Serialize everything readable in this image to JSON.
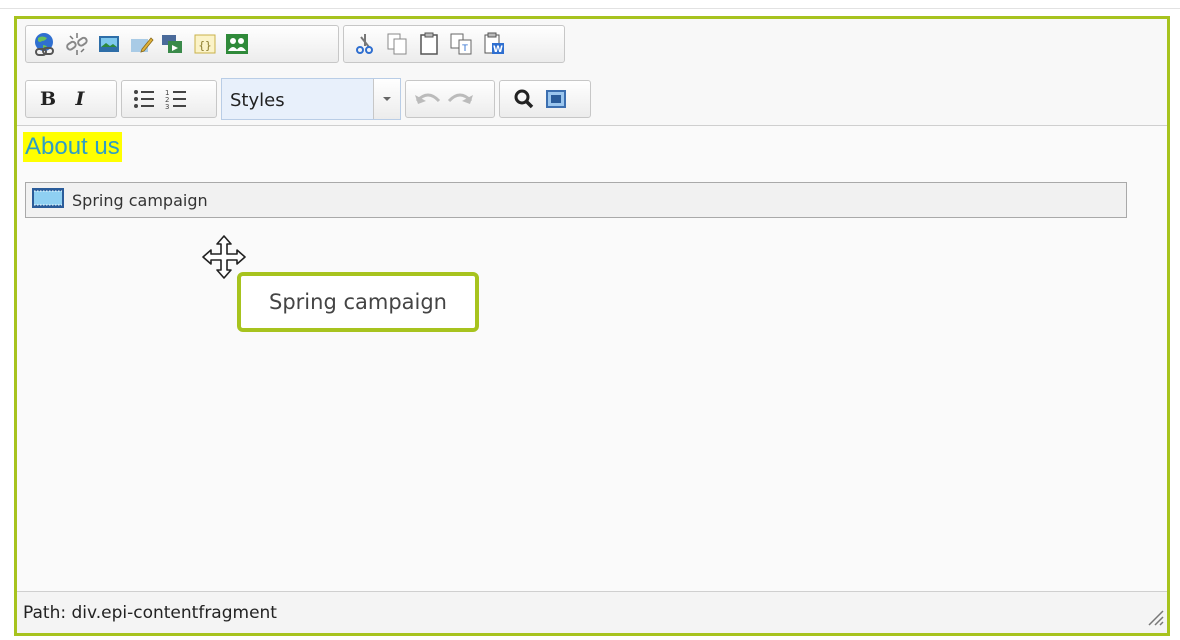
{
  "toolbar": {
    "row1_group1": [
      {
        "icon": "insert-link-icon"
      },
      {
        "icon": "unlink-icon"
      },
      {
        "icon": "insert-image-icon"
      },
      {
        "icon": "edit-image-icon"
      },
      {
        "icon": "insert-media-icon"
      },
      {
        "icon": "insert-block-icon"
      },
      {
        "icon": "personalized-content-icon"
      }
    ],
    "row1_group2": [
      {
        "icon": "cut-icon"
      },
      {
        "icon": "copy-icon"
      },
      {
        "icon": "paste-icon"
      },
      {
        "icon": "paste-text-icon"
      },
      {
        "icon": "paste-word-icon"
      }
    ],
    "bold_label": "B",
    "italic_label": "I",
    "styles_value": "Styles"
  },
  "content": {
    "heading": "About us",
    "fragment_label": "Spring campaign",
    "drag_tooltip": "Spring campaign"
  },
  "status": {
    "path": "Path: div.epi-contentfragment"
  },
  "colors": {
    "accent": "#a7c31e",
    "heading_highlight": "#ffff00",
    "heading_text": "#2e9ec5"
  }
}
